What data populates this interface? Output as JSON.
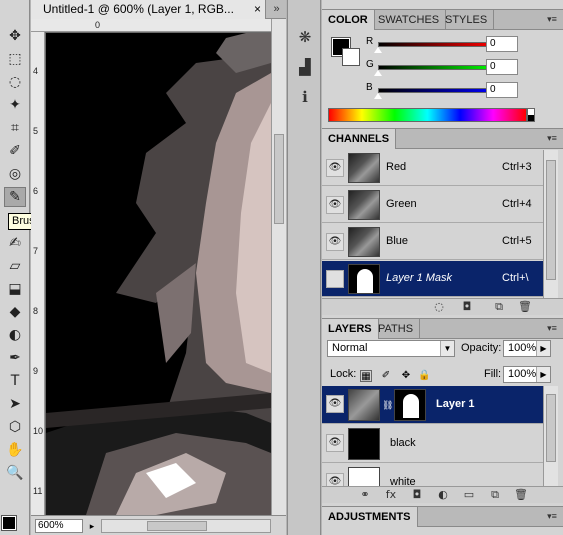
{
  "document": {
    "tab_title": "Untitled-1 @ 600% (Layer 1, RGB...",
    "tab_overflow": "»",
    "close_label": "×",
    "zoom": "600%",
    "ruler_top": [
      "0"
    ],
    "ruler_left": [
      "4",
      "5",
      "6",
      "7",
      "8",
      "9",
      "10",
      "11"
    ]
  },
  "toolbox": {
    "tooltip": "Brush Tool (B)",
    "tools": [
      "move-tool",
      "marquee-tool",
      "lasso-tool",
      "magic-wand-tool",
      "crop-tool",
      "eyedropper-tool",
      "spot-healing-tool",
      "brush-tool",
      "clone-stamp-tool",
      "history-brush-tool",
      "eraser-tool",
      "paint-bucket-tool",
      "blur-tool",
      "dodge-tool",
      "pen-tool",
      "type-tool",
      "path-selection-tool",
      "shape-tool",
      "hand-tool",
      "zoom-tool"
    ],
    "glyphs": [
      "✥",
      "⬚",
      "◌",
      "✦",
      "⌗",
      "✐",
      "◎",
      "✎",
      "⚇",
      "✍",
      "▱",
      "⬓",
      "◆",
      "◐",
      "✒",
      "T",
      "➤",
      "⬡",
      "✋",
      "🔍"
    ]
  },
  "iconstrip": {
    "icons": [
      "navigator-icon",
      "histogram-icon",
      "info-icon"
    ],
    "glyphs": [
      "❋",
      "▟",
      "ℹ"
    ]
  },
  "color_panel": {
    "tabs": [
      "COLOR",
      "SWATCHES",
      "STYLES"
    ],
    "sliders": [
      {
        "label": "R",
        "value": "0",
        "gradient": "linear-gradient(to right,#000,#f00)"
      },
      {
        "label": "G",
        "value": "0",
        "gradient": "linear-gradient(to right,#000,#0f0)"
      },
      {
        "label": "B",
        "value": "0",
        "gradient": "linear-gradient(to right,#000,#00f)"
      }
    ]
  },
  "channels_panel": {
    "tab": "CHANNELS",
    "rows": [
      {
        "name": "Red",
        "shortcut": "Ctrl+3",
        "eye": true,
        "selected": false,
        "mask": false
      },
      {
        "name": "Green",
        "shortcut": "Ctrl+4",
        "eye": true,
        "selected": false,
        "mask": false
      },
      {
        "name": "Blue",
        "shortcut": "Ctrl+5",
        "eye": true,
        "selected": false,
        "mask": false
      },
      {
        "name": "Layer 1 Mask",
        "shortcut": "Ctrl+\\",
        "eye": false,
        "selected": true,
        "mask": true
      }
    ]
  },
  "layers_panel": {
    "tabs": [
      "LAYERS",
      "PATHS"
    ],
    "blend_mode": "Normal",
    "opacity_label": "Opacity:",
    "opacity": "100%",
    "lock_label": "Lock:",
    "fill_label": "Fill:",
    "fill": "100%",
    "rows": [
      {
        "name": "Layer 1",
        "selected": true
      },
      {
        "name": "black",
        "selected": false
      },
      {
        "name": "white",
        "selected": false
      }
    ],
    "footer_icons": [
      "link-layers-icon",
      "fx-icon",
      "add-mask-icon",
      "adjustment-layer-icon",
      "new-group-icon",
      "new-layer-icon",
      "trash-icon"
    ],
    "footer_glyphs": [
      "⚭",
      "fx",
      "◘",
      "◐",
      "▭",
      "⧉",
      "🗑"
    ]
  },
  "adjustments_panel": {
    "tab": "ADJUSTMENTS"
  }
}
